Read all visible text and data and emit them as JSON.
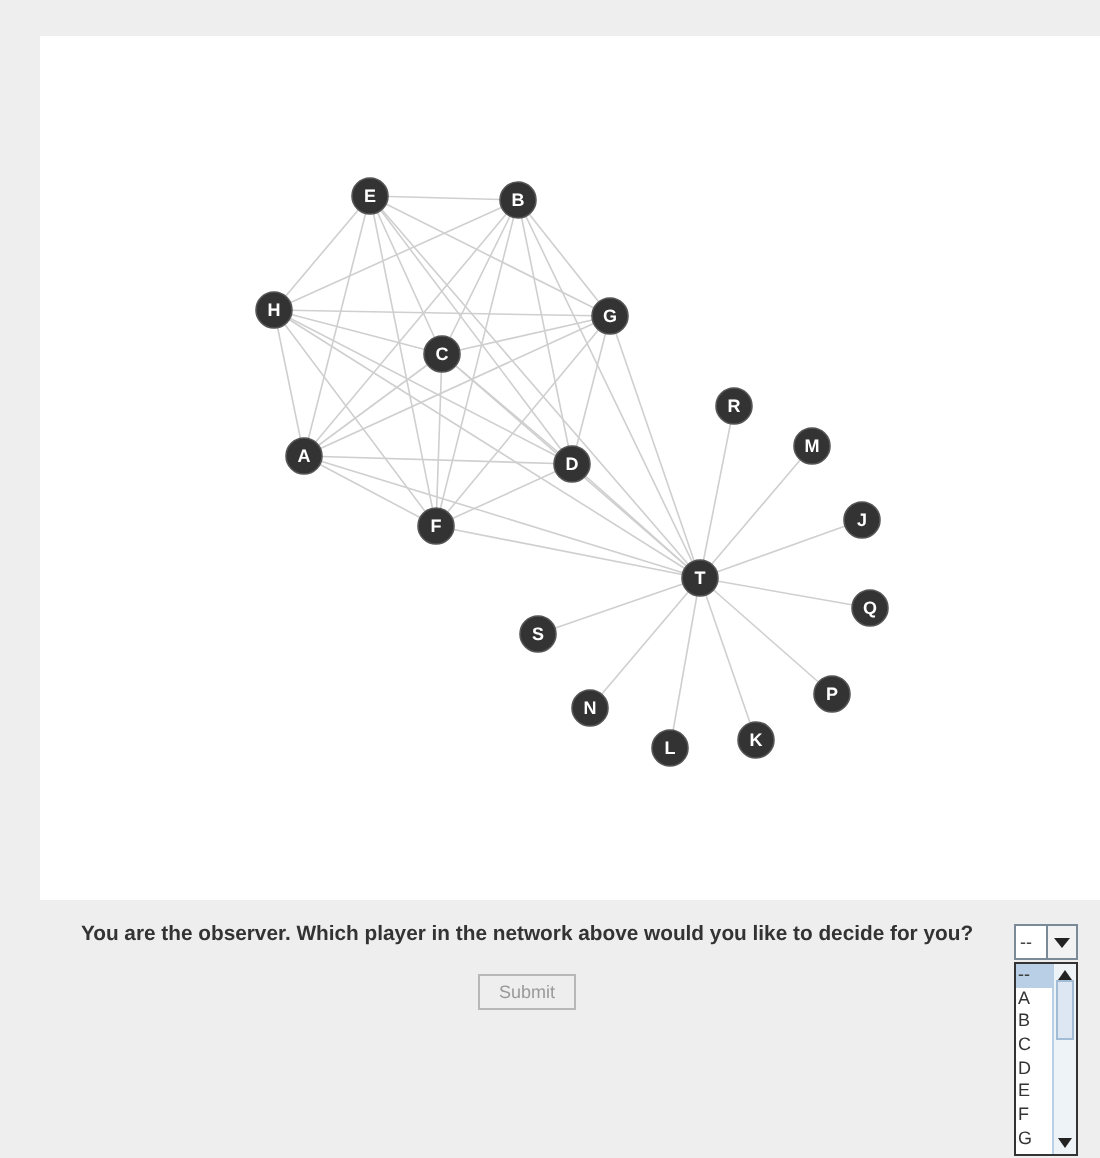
{
  "network": {
    "nodes": [
      {
        "label": "E",
        "kind": "cluster"
      },
      {
        "label": "B",
        "kind": "cluster"
      },
      {
        "label": "H",
        "kind": "cluster"
      },
      {
        "label": "G",
        "kind": "cluster"
      },
      {
        "label": "C",
        "kind": "cluster"
      },
      {
        "label": "R",
        "kind": "leaf"
      },
      {
        "label": "M",
        "kind": "leaf"
      },
      {
        "label": "A",
        "kind": "cluster"
      },
      {
        "label": "D",
        "kind": "cluster"
      },
      {
        "label": "J",
        "kind": "leaf"
      },
      {
        "label": "F",
        "kind": "cluster"
      },
      {
        "label": "T",
        "kind": "hub"
      },
      {
        "label": "Q",
        "kind": "leaf"
      },
      {
        "label": "S",
        "kind": "leaf"
      },
      {
        "label": "P",
        "kind": "leaf"
      },
      {
        "label": "N",
        "kind": "leaf"
      },
      {
        "label": "K",
        "kind": "leaf"
      },
      {
        "label": "L",
        "kind": "leaf"
      }
    ]
  },
  "question": "You are the observer. Which player in the network above would you like to decide for you?",
  "dropdown": {
    "value": "--",
    "options": [
      {
        "label": "--",
        "selected": true
      },
      {
        "label": "A",
        "selected": false
      },
      {
        "label": "B",
        "selected": false
      },
      {
        "label": "C",
        "selected": false
      },
      {
        "label": "D",
        "selected": false
      },
      {
        "label": "E",
        "selected": false
      },
      {
        "label": "F",
        "selected": false
      },
      {
        "label": "G",
        "selected": false
      }
    ]
  },
  "submit": {
    "label": "Submit",
    "disabled": true
  }
}
